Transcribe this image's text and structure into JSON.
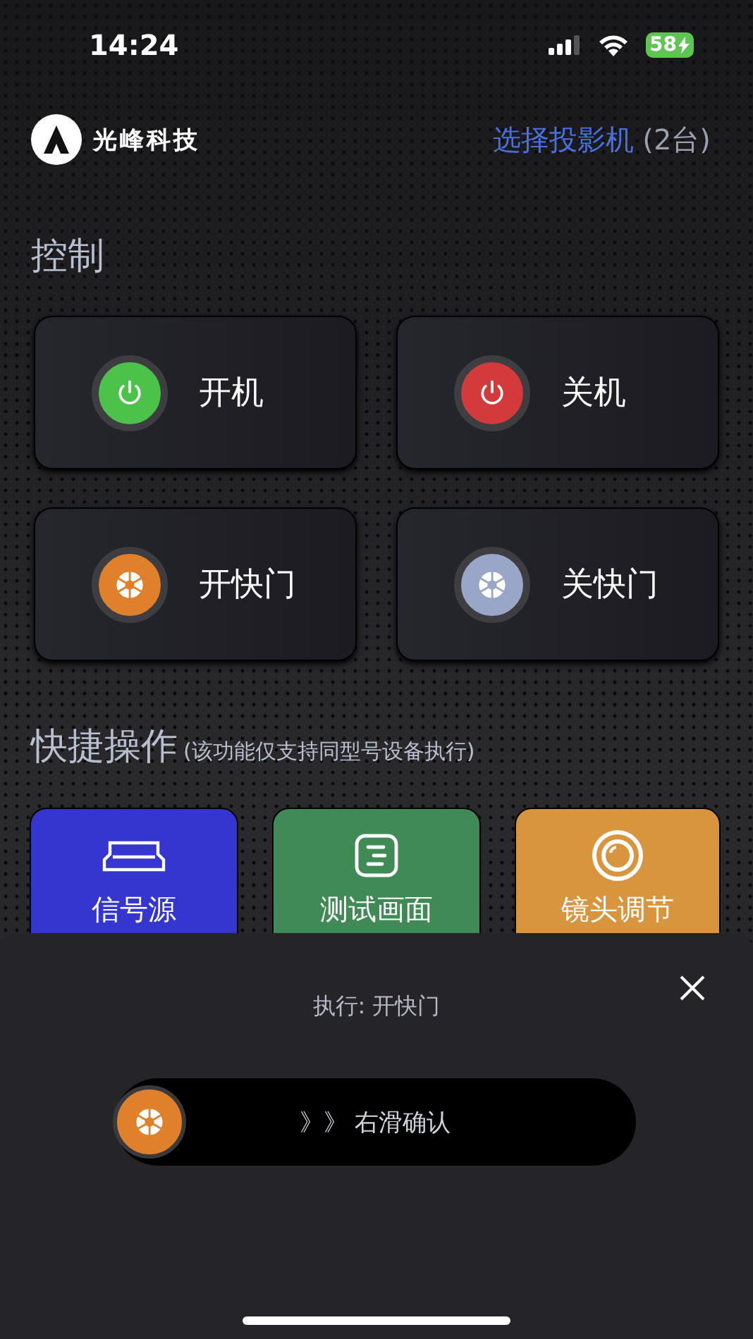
{
  "status_bar": {
    "time": "14:24",
    "battery": "58"
  },
  "header": {
    "brand": "光峰科技",
    "select_label": "选择投影机",
    "select_count": "(2台)"
  },
  "control": {
    "title": "控制",
    "buttons": [
      {
        "label": "开机",
        "kind": "power",
        "color": "#4cc24a"
      },
      {
        "label": "关机",
        "kind": "power",
        "color": "#d23a3c"
      },
      {
        "label": "开快门",
        "kind": "shutter",
        "color": "#e0802a"
      },
      {
        "label": "关快门",
        "kind": "shutter",
        "color": "#9aa6c8"
      }
    ]
  },
  "quick_actions": {
    "title": "快捷操作",
    "note": "(该功能仅支持同型号设备执行)",
    "items": [
      {
        "label": "信号源",
        "kind": "source",
        "color": "#3535d0"
      },
      {
        "label": "测试画面",
        "kind": "test",
        "color": "#3f8a55"
      },
      {
        "label": "镜头调节",
        "kind": "lens",
        "color": "#d8953d"
      }
    ]
  },
  "sheet": {
    "title": "执行: 开快门",
    "slider_hint": "》》 右滑确认",
    "thumb": {
      "kind": "shutter",
      "color": "#e0802a",
      "level": 0
    }
  }
}
